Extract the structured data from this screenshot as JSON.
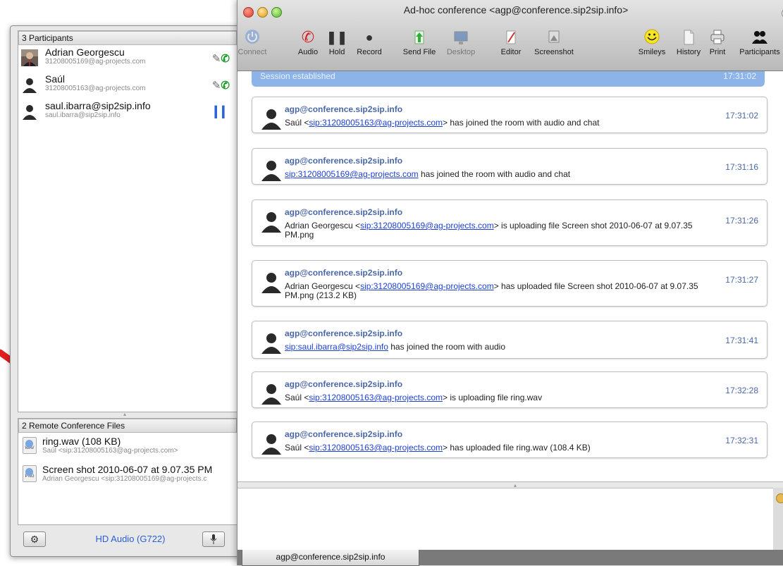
{
  "participants_panel": {
    "header": "3 Participants",
    "items": [
      {
        "name": "Adrian Georgescu",
        "address": "31208005169@ag-projects.com",
        "status": "audio-active"
      },
      {
        "name": "Saúl",
        "address": "31208005163@ag-projects.com",
        "status": "audio-active"
      },
      {
        "name": "saul.ibarra@sip2sip.info",
        "address": "saul.ibarra@sip2sip.info",
        "status": "audio-hold"
      }
    ]
  },
  "files_panel": {
    "header": "2 Remote Conference Files",
    "items": [
      {
        "name": "ring.wav (108 KB)",
        "sender": "Saúl <sip:31208005163@ag-projects.com>",
        "icon": "wav-file-icon",
        "icon_label": "WAV"
      },
      {
        "name": "Screen shot 2010-06-07 at 9.07.35 PM",
        "sender": "Adrian Georgescu <sip:31208005169@ag-projects.c",
        "icon": "png-file-icon",
        "icon_label": "PNG"
      }
    ]
  },
  "bottom_bar": {
    "audio_codec": "HD Audio (G722)"
  },
  "window": {
    "title": "Ad-hoc conference <agp@conference.sip2sip.info>"
  },
  "toolbar": {
    "connect": "Connect",
    "audio": "Audio",
    "hold": "Hold",
    "record": "Record",
    "send_file": "Send File",
    "desktop": "Desktop",
    "editor": "Editor",
    "screenshot": "Screenshot",
    "smileys": "Smileys",
    "history": "History",
    "print": "Print",
    "participants": "Participants"
  },
  "chat": {
    "banner": {
      "text": "Session established",
      "time": "17:31:02"
    },
    "messages": [
      {
        "sender": "agp@conference.sip2sip.info",
        "prefix": "Saúl <",
        "link": "sip:31208005163@ag-projects.com",
        "suffix": "> has joined the room with audio and chat",
        "time": "17:31:02"
      },
      {
        "sender": "agp@conference.sip2sip.info",
        "prefix": "",
        "link": "sip:31208005169@ag-projects.com",
        "suffix": " has joined the room with audio and chat",
        "time": "17:31:16"
      },
      {
        "sender": "agp@conference.sip2sip.info",
        "prefix": "Adrian Georgescu <",
        "link": "sip:31208005169@ag-projects.com",
        "suffix": "> is uploading file Screen shot 2010-06-07 at 9.07.35 PM.png",
        "time": "17:31:26"
      },
      {
        "sender": "agp@conference.sip2sip.info",
        "prefix": "Adrian Georgescu <",
        "link": "sip:31208005169@ag-projects.com",
        "suffix": "> has uploaded file Screen shot 2010-06-07 at 9.07.35 PM.png (213.2 KB)",
        "time": "17:31:27"
      },
      {
        "sender": "agp@conference.sip2sip.info",
        "prefix": "",
        "link": "sip:saul.ibarra@sip2sip.info",
        "suffix": " has joined the room with audio",
        "time": "17:31:41"
      },
      {
        "sender": "agp@conference.sip2sip.info",
        "prefix": "Saúl <",
        "link": "sip:31208005163@ag-projects.com",
        "suffix": "> is uploading file ring.wav",
        "time": "17:32:28"
      },
      {
        "sender": "agp@conference.sip2sip.info",
        "prefix": "Saúl <",
        "link": "sip:31208005163@ag-projects.com",
        "suffix": "> has uploaded file ring.wav (108.4 KB)",
        "time": "17:32:31"
      }
    ]
  },
  "tab": {
    "label": "agp@conference.sip2sip.info"
  },
  "colors": {
    "link": "#1d3fd4",
    "sender": "#4a67a8",
    "banner": "#8db4e8",
    "accent": "#2a5fd1",
    "arrow": "#e02020"
  }
}
